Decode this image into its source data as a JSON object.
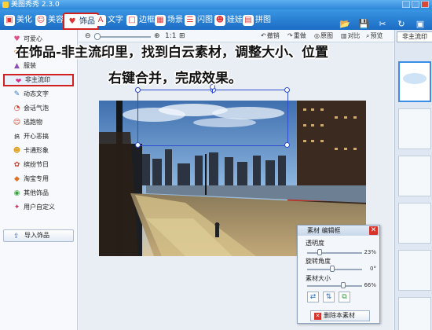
{
  "window": {
    "title": "美图秀秀 2.3.0"
  },
  "tabs": [
    {
      "label": "美化",
      "icon": "picture-icon"
    },
    {
      "label": "美容",
      "icon": "face-icon"
    },
    {
      "label": "饰品",
      "icon": "heart-icon"
    },
    {
      "label": "文字",
      "icon": "text-icon"
    },
    {
      "label": "边框",
      "icon": "frame-icon"
    },
    {
      "label": "场景",
      "icon": "scene-icon"
    },
    {
      "label": "闪图",
      "icon": "flash-icon"
    },
    {
      "label": "娃娃",
      "icon": "doll-icon"
    },
    {
      "label": "拼图",
      "icon": "puzzle-icon"
    }
  ],
  "tools": [
    {
      "label": "打开",
      "glyph": "📂"
    },
    {
      "label": "保存",
      "glyph": "💾"
    },
    {
      "label": "抠图",
      "glyph": "✂"
    },
    {
      "label": "旋转",
      "glyph": "↻"
    },
    {
      "label": "裁剪",
      "glyph": "▣"
    }
  ],
  "toolbar2": {
    "zoom_label": "1:1",
    "undo": "撤销",
    "redo": "重做",
    "original": "原图",
    "compare": "对比",
    "preview": "预览"
  },
  "sidebar": {
    "items": [
      {
        "label": "可爱心",
        "glyph": "♥",
        "color": "#e0508a"
      },
      {
        "label": "饰品",
        "glyph": "❀",
        "color": "#e07b2a"
      },
      {
        "label": "服装",
        "glyph": "▲",
        "color": "#8a4fb5"
      },
      {
        "label": "非主流印",
        "glyph": "❤",
        "color": "#d0308a"
      },
      {
        "label": "动态文字",
        "glyph": "✎",
        "color": "#3a7ad0"
      },
      {
        "label": "会话气泡",
        "glyph": "◔",
        "color": "#d04030"
      },
      {
        "label": "逃跑物",
        "glyph": "☺",
        "color": "#d04030"
      },
      {
        "label": "开心恶搞",
        "glyph": "搞",
        "color": "#333333"
      },
      {
        "label": "卡通形象",
        "glyph": "☻",
        "color": "#e0a020"
      },
      {
        "label": "缤纷节日",
        "glyph": "✿",
        "color": "#d04030"
      },
      {
        "label": "淘宝专用",
        "glyph": "◆",
        "color": "#e07020"
      },
      {
        "label": "其他饰品",
        "glyph": "◉",
        "color": "#3aa040"
      },
      {
        "label": "用户自定义",
        "glyph": "✦",
        "color": "#d03060"
      }
    ],
    "import_label": "导入饰品"
  },
  "right_panel": {
    "tab_label": "非主流印"
  },
  "overlay": {
    "line1": "在饰品-非主流印里，找到白云素材，调整大小、位置",
    "line2": "右键合并，完成效果。"
  },
  "dialog": {
    "title": "素材 编辑框",
    "transparency_label": "透明度",
    "transparency_value": "23%",
    "transparency": 0.23,
    "rotation_label": "旋转角度",
    "rotation_value": "0°",
    "rotation": 0.45,
    "size_label": "素材大小",
    "size_value": "66%",
    "size": 0.66,
    "delete_label": "删除本素材"
  }
}
